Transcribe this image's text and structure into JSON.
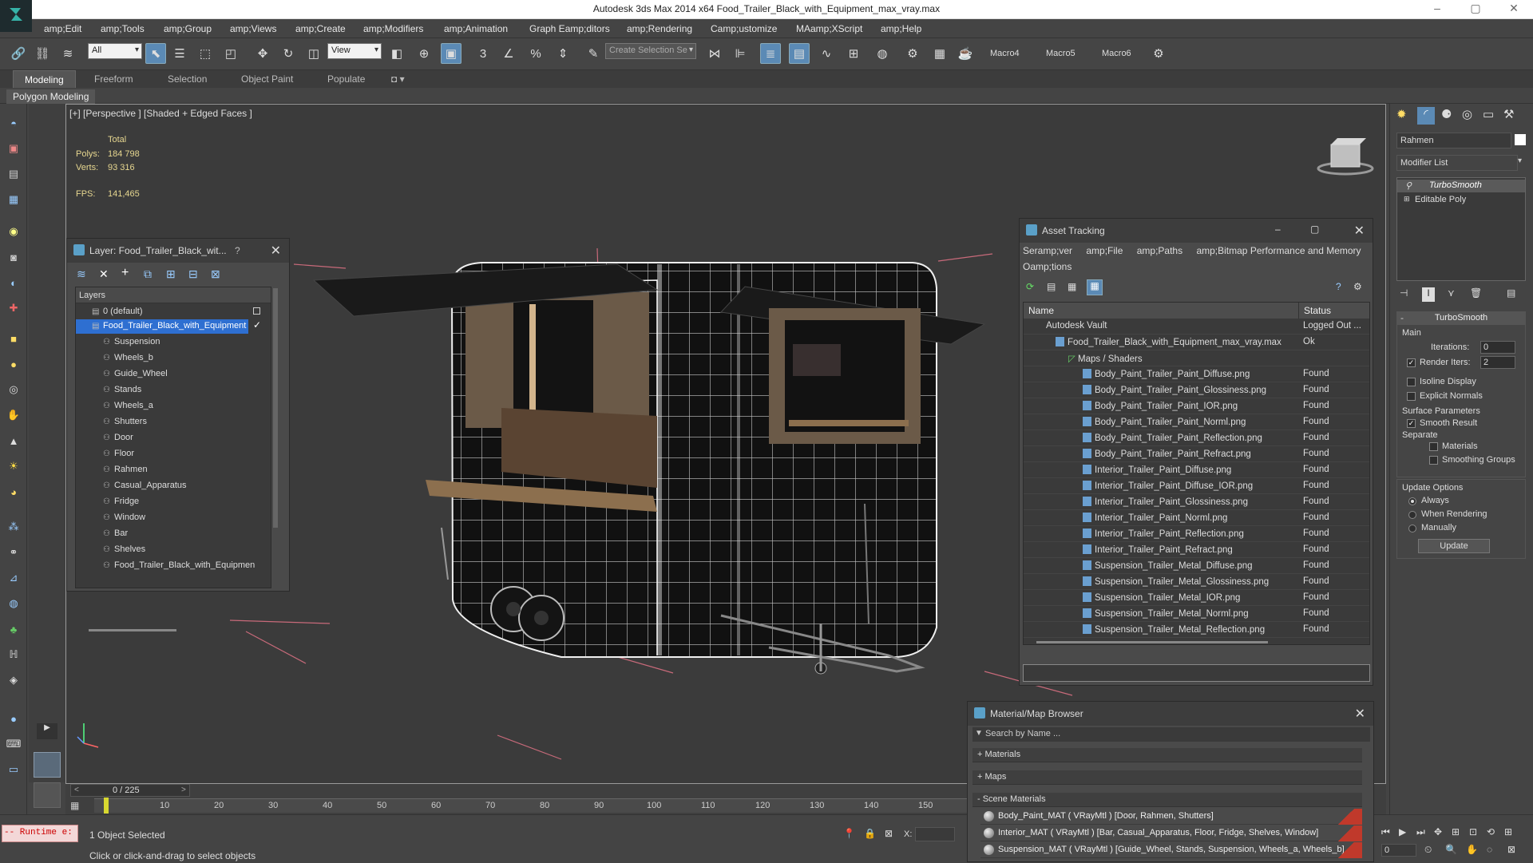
{
  "app": {
    "title": "Autodesk 3ds Max  2014 x64     Food_Trailer_Black_with_Equipment_max_vray.max"
  },
  "menu": [
    "amp;Edit",
    "amp;Tools",
    "amp;Group",
    "amp;Views",
    "amp;Create",
    "amp;Modifiers",
    "amp;Animation",
    "Graph Eamp;ditors",
    "amp;Rendering",
    "Camp;ustomize",
    "MAamp;XScript",
    "amp;Help"
  ],
  "toolbar": {
    "filter_value": "All",
    "view_value": "View",
    "selection_set_placeholder": "Create Selection Se",
    "macros": [
      "Macro4",
      "Macro5",
      "Macro6"
    ]
  },
  "ribbon": {
    "tabs": [
      "Modeling",
      "Freeform",
      "Selection",
      "Object Paint",
      "Populate"
    ],
    "subtab": "Polygon Modeling"
  },
  "viewport": {
    "label": "[+] [Perspective ] [Shaded + Edged Faces ]",
    "total_label": "Total",
    "polys_label": "Polys:",
    "polys": "184 798",
    "verts_label": "Verts:",
    "verts": "93 316",
    "fps_label": "FPS:",
    "fps": "141,465"
  },
  "layer_panel": {
    "title": "Layer: Food_Trailer_Black_wit...",
    "help": "?",
    "list_header": "Layers",
    "layers": [
      {
        "name": "0 (default)"
      },
      {
        "name": "Food_Trailer_Black_with_Equipment"
      },
      {
        "name": "Suspension"
      },
      {
        "name": "Wheels_b"
      },
      {
        "name": "Guide_Wheel"
      },
      {
        "name": "Stands"
      },
      {
        "name": "Wheels_a"
      },
      {
        "name": "Shutters"
      },
      {
        "name": "Door"
      },
      {
        "name": "Floor"
      },
      {
        "name": "Rahmen"
      },
      {
        "name": "Casual_Apparatus"
      },
      {
        "name": "Fridge"
      },
      {
        "name": "Window"
      },
      {
        "name": "Bar"
      },
      {
        "name": "Shelves"
      },
      {
        "name": "Food_Trailer_Black_with_Equipmen"
      }
    ]
  },
  "asset_panel": {
    "title": "Asset Tracking",
    "menu": [
      "Seramp;ver",
      "amp;File",
      "amp;Paths",
      "amp;Bitmap Performance and Memory",
      "Oamp;tions"
    ],
    "col_name": "Name",
    "col_status": "Status",
    "rows": [
      {
        "name": "Autodesk Vault",
        "status": "Logged Out ..."
      },
      {
        "name": "Food_Trailer_Black_with_Equipment_max_vray.max",
        "status": "Ok"
      },
      {
        "name": "Maps / Shaders",
        "status": ""
      },
      {
        "name": "Body_Paint_Trailer_Paint_Diffuse.png",
        "status": "Found"
      },
      {
        "name": "Body_Paint_Trailer_Paint_Glossiness.png",
        "status": "Found"
      },
      {
        "name": "Body_Paint_Trailer_Paint_IOR.png",
        "status": "Found"
      },
      {
        "name": "Body_Paint_Trailer_Paint_Norml.png",
        "status": "Found"
      },
      {
        "name": "Body_Paint_Trailer_Paint_Reflection.png",
        "status": "Found"
      },
      {
        "name": "Body_Paint_Trailer_Paint_Refract.png",
        "status": "Found"
      },
      {
        "name": "Interior_Trailer_Paint_Diffuse.png",
        "status": "Found"
      },
      {
        "name": "Interior_Trailer_Paint_Diffuse_IOR.png",
        "status": "Found"
      },
      {
        "name": "Interior_Trailer_Paint_Glossiness.png",
        "status": "Found"
      },
      {
        "name": "Interior_Trailer_Paint_Norml.png",
        "status": "Found"
      },
      {
        "name": "Interior_Trailer_Paint_Reflection.png",
        "status": "Found"
      },
      {
        "name": "Interior_Trailer_Paint_Refract.png",
        "status": "Found"
      },
      {
        "name": "Suspension_Trailer_Metal_Diffuse.png",
        "status": "Found"
      },
      {
        "name": "Suspension_Trailer_Metal_Glossiness.png",
        "status": "Found"
      },
      {
        "name": "Suspension_Trailer_Metal_IOR.png",
        "status": "Found"
      },
      {
        "name": "Suspension_Trailer_Metal_Norml.png",
        "status": "Found"
      },
      {
        "name": "Suspension_Trailer_Metal_Reflection.png",
        "status": "Found"
      }
    ]
  },
  "mat_panel": {
    "title": "Material/Map Browser",
    "search_placeholder": "Search by Name ...",
    "sections": [
      "+ Materials",
      "+ Maps",
      "- Scene Materials"
    ],
    "materials": [
      "Body_Paint_MAT  ( VRayMtl ) [Door, Rahmen, Shutters]",
      "Interior_MAT  ( VRayMtl ) [Bar, Casual_Apparatus, Floor, Fridge, Shelves, Window]",
      "Suspension_MAT  ( VRayMtl ) [Guide_Wheel, Stands, Suspension, Wheels_a, Wheels_b]"
    ]
  },
  "command_panel": {
    "object_name": "Rahmen",
    "modifier_list": "Modifier List",
    "stack": [
      "TurboSmooth",
      "Editable Poly"
    ],
    "rollout": "TurboSmooth",
    "main": "Main",
    "iterations_label": "Iterations:",
    "iterations": "0",
    "render_iters_label": "Render Iters:",
    "render_iters": "2",
    "isoline": "Isoline Display",
    "explicit": "Explicit Normals",
    "surface": "Surface Parameters",
    "smooth_result": "Smooth Result",
    "separate": "Separate",
    "materials": "Materials",
    "smoothing_groups": "Smoothing Groups",
    "update_options": "Update Options",
    "always": "Always",
    "when_rendering": "When Rendering",
    "manually": "Manually",
    "update": "Update"
  },
  "timeline": {
    "frame": "0 / 225",
    "ticks": [
      "10",
      "20",
      "30",
      "40",
      "50",
      "60",
      "70",
      "80",
      "90",
      "100",
      "110",
      "120",
      "130",
      "140",
      "150"
    ]
  },
  "status": {
    "selected": "1 Object Selected",
    "hint": "Click or click-and-drag to select objects",
    "runtime": "-- Runtime e:",
    "x_label": "X:",
    "spinner_value": "0"
  }
}
